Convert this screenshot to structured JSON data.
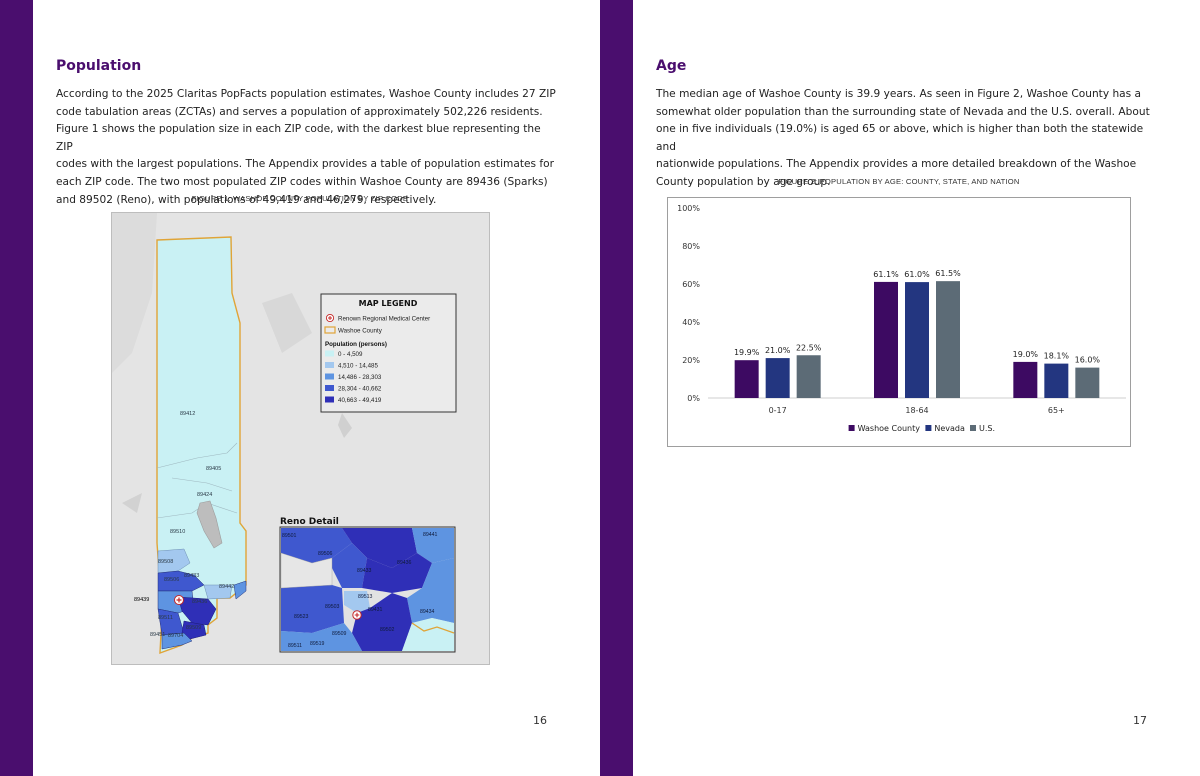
{
  "left_page": {
    "heading": "Population",
    "paragraph_lines": [
      "According to the 2025 Claritas PopFacts population estimates, Washoe County includes 27 ZIP",
      "code tabulation areas (ZCTAs) and serves a population of approximately 502,226 residents.",
      "Figure 1 shows the population size in each ZIP code, with the darkest blue representing the ZIP",
      "codes with the largest populations. The Appendix provides a table of population estimates for",
      "each ZIP code. The two most populated ZIP codes within Washoe County are 89436 (Sparks)",
      "and 89502 (Reno), with populations of 49,419 and 46,279, respectively."
    ],
    "figure_caption": "FIGURE 1: WASHOE COUNTY POPULATION BY ZIP CODE",
    "page_number": "16"
  },
  "map": {
    "legend": {
      "title": "MAP LEGEND",
      "items": [
        "Renown Regional Medical Center",
        "Washoe County"
      ],
      "population_title": "Population (persons)",
      "classes": [
        {
          "label": "0 - 4,509",
          "color": "#c9f1f4"
        },
        {
          "label": "4,510 - 14,485",
          "color": "#a3c8ef"
        },
        {
          "label": "14,486 - 28,303",
          "color": "#5e94e1"
        },
        {
          "label": "28,304 - 40,662",
          "color": "#3f58cf"
        },
        {
          "label": "40,663 - 49,419",
          "color": "#2f2fb7"
        }
      ]
    },
    "main_zip_labels": [
      "89412",
      "89405",
      "89424",
      "89510",
      "89508",
      "89506",
      "89433",
      "89442",
      "89439",
      "89511",
      "89509",
      "89451",
      "89704",
      "89436"
    ],
    "detail_title": "Reno Detail",
    "detail_zip_labels": [
      "89441",
      "89506",
      "89436",
      "89433",
      "89523",
      "89513",
      "89503",
      "89431",
      "89434",
      "89509",
      "89502",
      "89511",
      "89519",
      "89501"
    ]
  },
  "right_page": {
    "heading": "Age",
    "paragraph_lines": [
      "The median age of Washoe County is 39.9 years. As seen in Figure 2, Washoe County has a",
      "somewhat older population than the surrounding state of Nevada and the U.S. overall. About",
      "one in five individuals (19.0%) is aged 65 or above, which is higher than both the statewide and",
      "nationwide populations. The Appendix provides a more detailed breakdown of the Washoe",
      "County population by age group."
    ],
    "figure_caption": "FIGURE 2: POPULATION BY AGE: COUNTY, STATE, AND NATION",
    "page_number": "17"
  },
  "chart_data": {
    "type": "bar",
    "title": "",
    "xlabel": "",
    "ylabel": "",
    "categories": [
      "0-17",
      "18-64",
      "65+"
    ],
    "series": [
      {
        "name": "Washoe County",
        "values": [
          19.9,
          61.1,
          19.0
        ],
        "labels": [
          "19.9%",
          "61.1%",
          "19.0%"
        ],
        "color": "#3d0a62"
      },
      {
        "name": "Nevada",
        "values": [
          21.0,
          61.0,
          18.1
        ],
        "labels": [
          "21.0%",
          "61.0%",
          "18.1%"
        ],
        "color": "#233680"
      },
      {
        "name": "U.S.",
        "values": [
          22.5,
          61.5,
          16.0
        ],
        "labels": [
          "22.5%",
          "61.5%",
          "16.0%"
        ],
        "color": "#5c6b76"
      }
    ],
    "ylim": [
      0,
      100
    ],
    "yticks": [
      0,
      20,
      40,
      60,
      80,
      100
    ],
    "ytick_labels": [
      "0%",
      "20%",
      "40%",
      "60%",
      "80%",
      "100%"
    ],
    "grid": false,
    "legend_position": "bottom-center"
  }
}
